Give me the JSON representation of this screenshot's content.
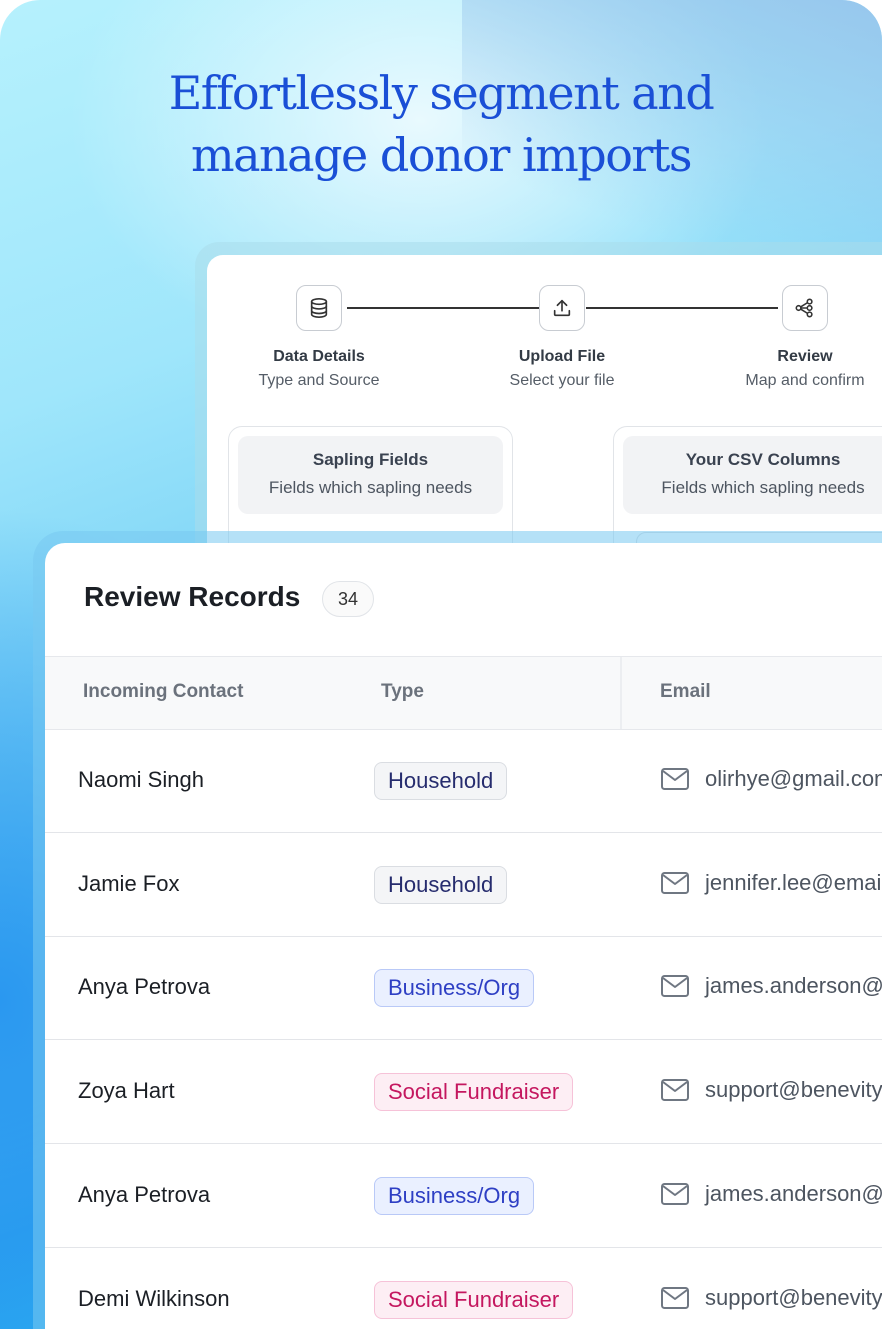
{
  "headline": {
    "line1": "Effortlessly segment and",
    "line2": "manage donor imports"
  },
  "steps": [
    {
      "title": "Data Details",
      "subtitle": "Type and Source",
      "icon": "database-icon"
    },
    {
      "title": "Upload File",
      "subtitle": "Select your file",
      "icon": "upload-icon"
    },
    {
      "title": "Review",
      "subtitle": "Map and confirm",
      "icon": "share-nodes-icon"
    }
  ],
  "fields": {
    "sapling": {
      "title": "Sapling Fields",
      "subtitle": "Fields which sapling needs"
    },
    "csv": {
      "title": "Your CSV Columns",
      "subtitle": "Fields which sapling needs"
    }
  },
  "review": {
    "title": "Review Records",
    "count": "34",
    "columns": [
      "Incoming Contact",
      "Type",
      "Email"
    ],
    "rows": [
      {
        "name": "Naomi Singh",
        "type": "Household",
        "kind": "household",
        "email": "olirhye@gmail.com"
      },
      {
        "name": "Jamie Fox",
        "type": "Household",
        "kind": "household",
        "email": "jennifer.lee@email.com"
      },
      {
        "name": "Anya Petrova",
        "type": "Business/Org",
        "kind": "business",
        "email": "james.anderson@email.com"
      },
      {
        "name": "Zoya Hart",
        "type": "Social Fundraiser",
        "kind": "social",
        "email": "support@benevity.com"
      },
      {
        "name": "Anya Petrova",
        "type": "Business/Org",
        "kind": "business",
        "email": "james.anderson@email.com"
      },
      {
        "name": "Demi Wilkinson",
        "type": "Social Fundraiser",
        "kind": "social",
        "email": "support@benevity.com"
      }
    ]
  },
  "colors": {
    "headline": "#1a4fd6",
    "household_text": "#262c6e",
    "business_text": "#2e3fc4",
    "social_text": "#c4175f"
  }
}
